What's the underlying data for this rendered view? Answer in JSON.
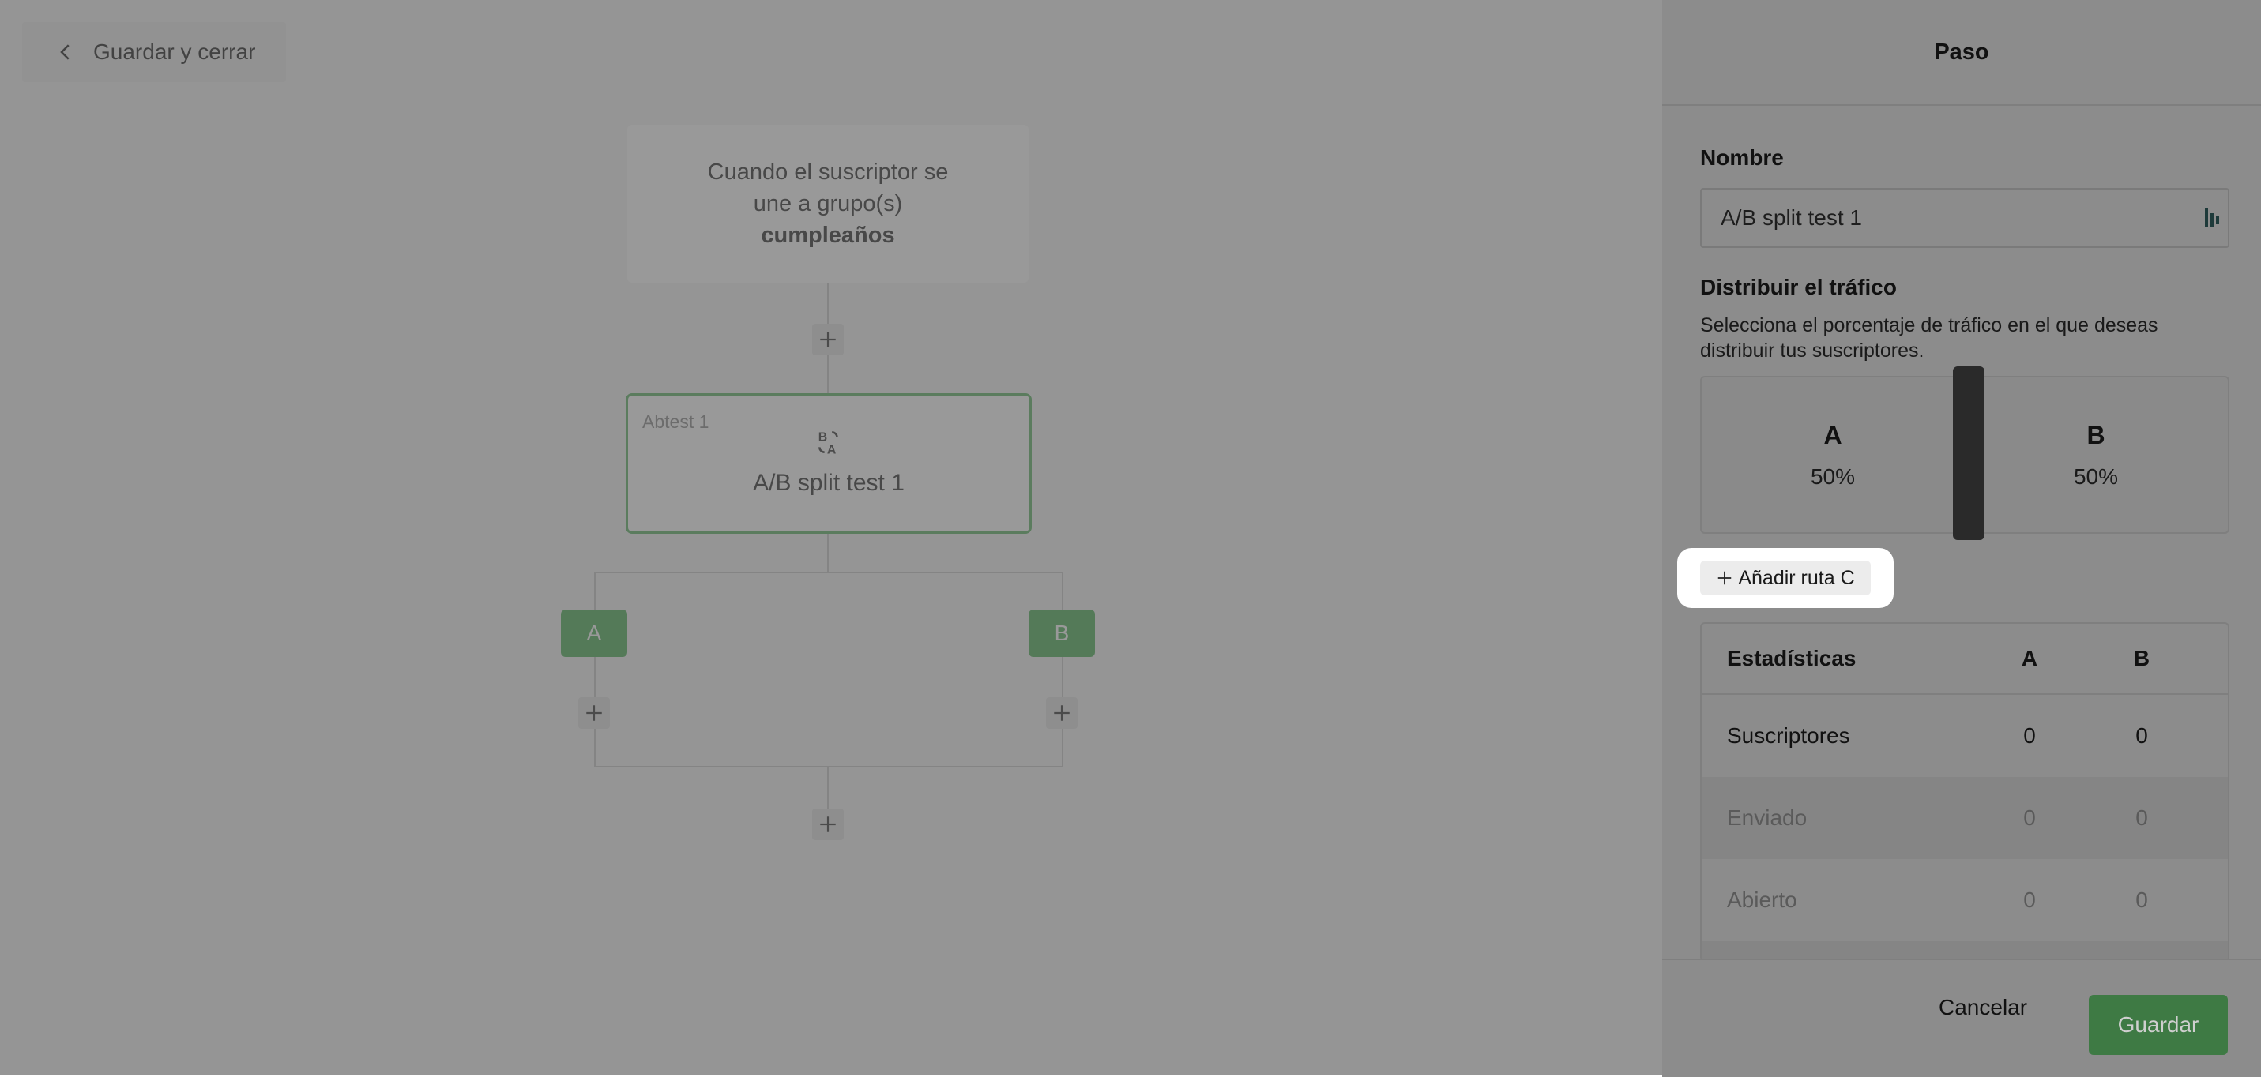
{
  "header": {
    "back_label": "Guardar y cerrar"
  },
  "flow": {
    "trigger": {
      "line1": "Cuando el suscriptor se",
      "line2": "une a grupo(s)",
      "group": "cumpleaños"
    },
    "ab_node": {
      "tag": "Abtest 1",
      "title": "A/B split test 1"
    },
    "branches": [
      "A",
      "B"
    ]
  },
  "panel": {
    "title": "Paso",
    "name_label": "Nombre",
    "name_value": "A/B split test 1",
    "traffic_label": "Distribuir el tráfico",
    "traffic_desc": "Selecciona el porcentaje de tráfico en el que deseas distribuir tus suscriptores.",
    "split": [
      {
        "label": "A",
        "percent": "50%"
      },
      {
        "label": "B",
        "percent": "50%"
      }
    ],
    "add_route_label": "Añadir ruta C",
    "stats": {
      "headers": [
        "Estadísticas",
        "A",
        "B"
      ],
      "rows": [
        {
          "label": "Suscriptores",
          "a": "0",
          "b": "0"
        },
        {
          "label": "Enviado",
          "a": "0",
          "b": "0"
        },
        {
          "label": "Abierto",
          "a": "0",
          "b": "0"
        }
      ]
    },
    "cancel_label": "Cancelar",
    "save_label": "Guardar"
  },
  "colors": {
    "accent_green": "#4bae56",
    "selected_border": "#5cb365",
    "handle": "#2a2a2a"
  }
}
